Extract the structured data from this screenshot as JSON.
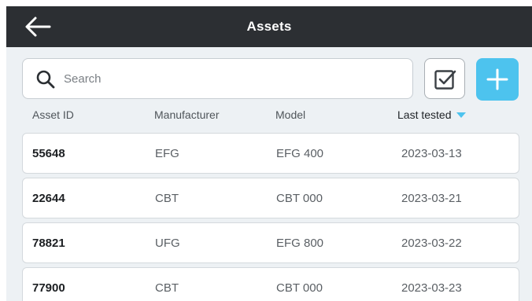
{
  "header": {
    "title": "Assets",
    "back_icon": "arrow-left-icon"
  },
  "search": {
    "placeholder": "Search",
    "value": "",
    "icon": "search-icon"
  },
  "actions": {
    "select_icon": "checkbox-checked-icon",
    "add_icon": "plus-icon",
    "accent_color": "#4dc3ee"
  },
  "table": {
    "columns": [
      "Asset ID",
      "Manufacturer",
      "Model",
      "Last tested"
    ],
    "sort_column": "Last tested",
    "sort_direction": "descending",
    "rows": [
      {
        "asset_id": "55648",
        "manufacturer": "EFG",
        "model": "EFG 400",
        "last_tested": "2023-03-13"
      },
      {
        "asset_id": "22644",
        "manufacturer": "CBT",
        "model": "CBT 000",
        "last_tested": "2023-03-21"
      },
      {
        "asset_id": "78821",
        "manufacturer": "UFG",
        "model": "EFG 800",
        "last_tested": "2023-03-22"
      },
      {
        "asset_id": "77900",
        "manufacturer": "CBT",
        "model": "CBT 000",
        "last_tested": "2023-03-23"
      }
    ]
  }
}
